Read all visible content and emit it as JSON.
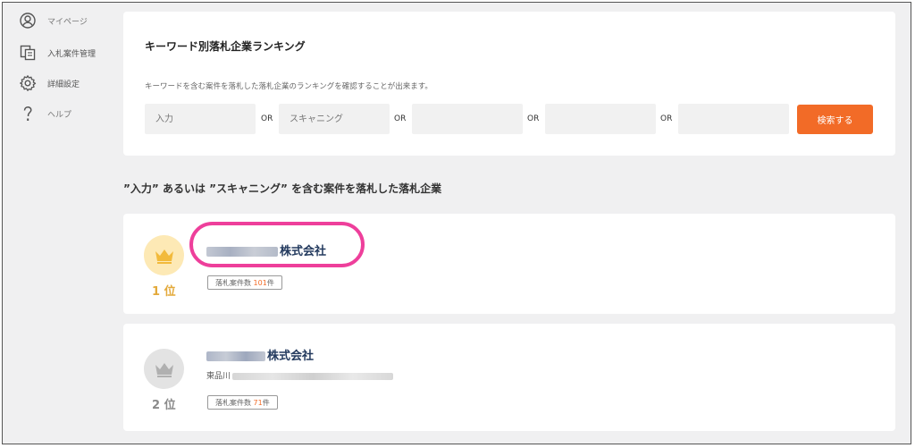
{
  "sidebar": {
    "items": [
      {
        "label": "マイページ",
        "icon": "user-circle-icon"
      },
      {
        "label": "入札案件管理",
        "icon": "documents-icon"
      },
      {
        "label": "詳細設定",
        "icon": "gear-icon"
      },
      {
        "label": "ヘルプ",
        "icon": "question-icon"
      }
    ]
  },
  "search": {
    "title": "キーワード別落札企業ランキング",
    "description": "キーワードを含む案件を落札した落札企業のランキングを確認することが出来ます。",
    "keywords": [
      "入力",
      "スキャニング",
      "",
      "",
      ""
    ],
    "or_label": "OR",
    "button_label": "検索する"
  },
  "results": {
    "heading": "”入力” あるいは ”スキャニング” を含む案件を落札した落札企業",
    "items": [
      {
        "rank_label": "1 位",
        "company_suffix": "株式会社",
        "address": "",
        "count_prefix": "落札案件数 ",
        "count": "101",
        "count_suffix": "件",
        "crown_color": "#f2ba3b",
        "circle_color": "#fde9b5",
        "rank_color": "#e3a93a"
      },
      {
        "rank_label": "2 位",
        "company_suffix": "株式会社",
        "address": "東品川",
        "count_prefix": "落札案件数 ",
        "count": "71",
        "count_suffix": "件",
        "crown_color": "#b0b0b0",
        "circle_color": "#e3e3e3",
        "rank_color": "#8a8a8a"
      }
    ]
  },
  "colors": {
    "accent": "#f26b27",
    "highlight": "#ee3f9b",
    "company_text": "#233a5e"
  }
}
